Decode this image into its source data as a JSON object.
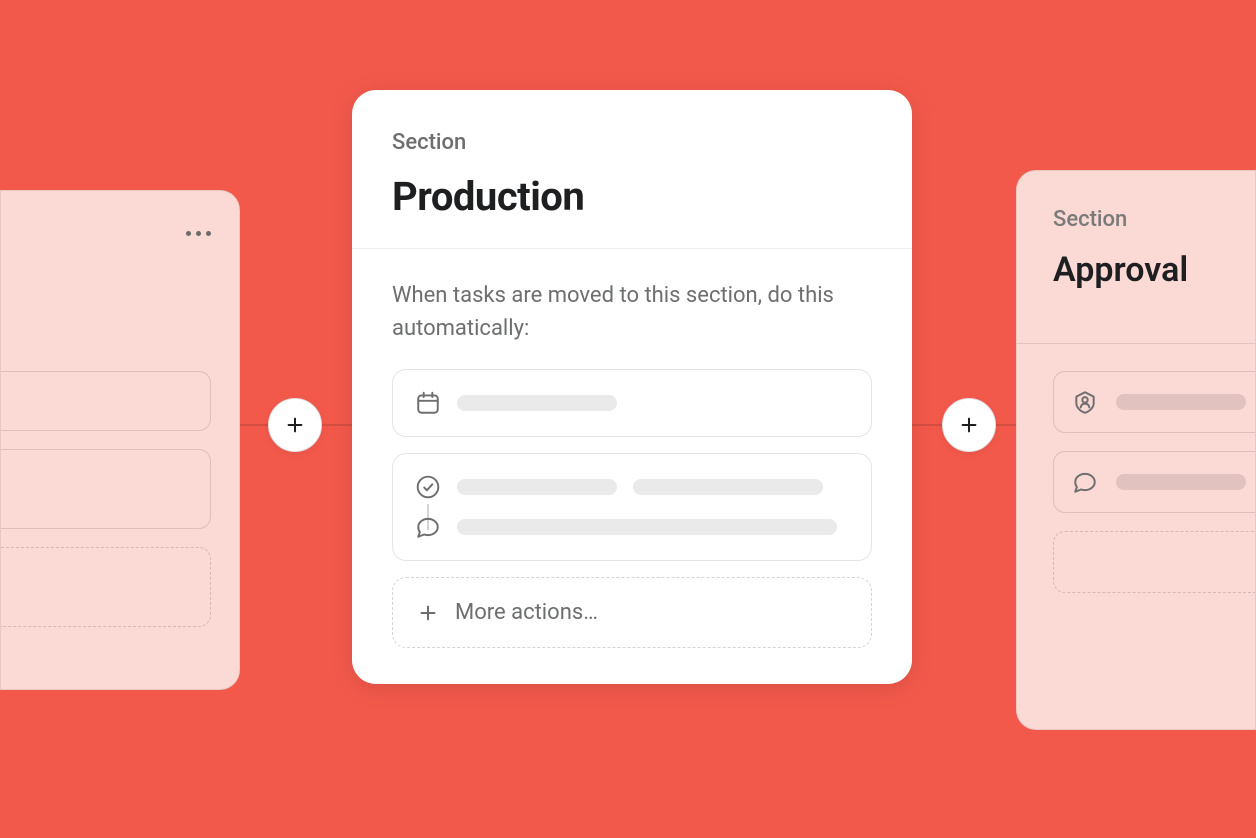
{
  "main_card": {
    "section_label": "Section",
    "title": "Production",
    "description": "When tasks are moved to this section, do this automatically:",
    "more_actions_label": "More actions…"
  },
  "right_card": {
    "section_label": "Section",
    "title": "Approval"
  },
  "icons": {
    "calendar": "calendar-icon",
    "check_circle": "check-circle-icon",
    "comment": "comment-icon",
    "assignee": "assignee-icon",
    "plus": "plus-icon",
    "more": "more-icon"
  }
}
